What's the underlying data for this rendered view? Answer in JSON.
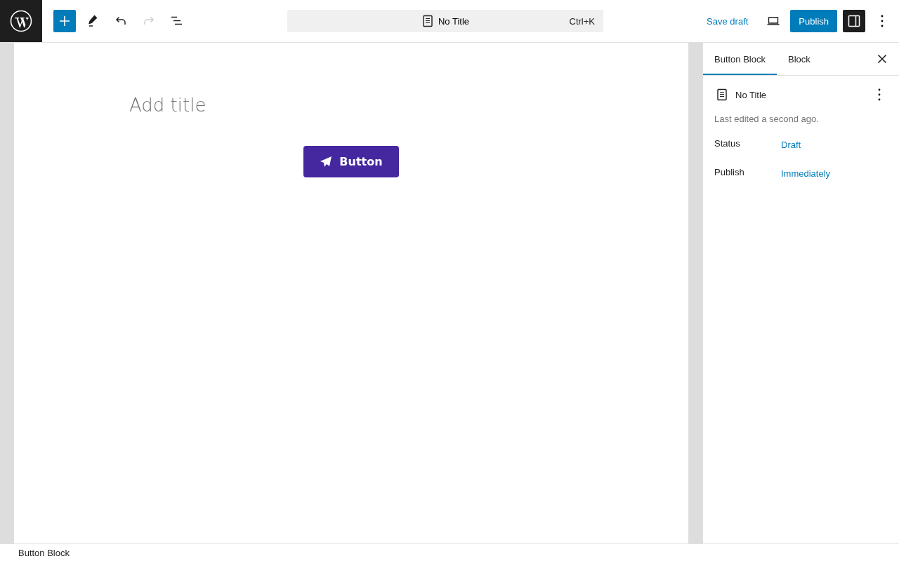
{
  "toolbar": {
    "undo": {
      "disabled": false
    },
    "redo": {
      "disabled": true
    }
  },
  "command_bar": {
    "document_title": "No Title",
    "shortcut": "Ctrl+K"
  },
  "actions": {
    "save_draft": "Save draft",
    "publish": "Publish",
    "settings_toggle": {
      "pressed": true
    }
  },
  "canvas": {
    "title_placeholder": "Add title",
    "button_label": "Button"
  },
  "sidebar": {
    "tabs": [
      {
        "label": "Button Block",
        "selected": true
      },
      {
        "label": "Block",
        "selected": false
      }
    ],
    "document_title": "No Title",
    "last_edited": "Last edited a second ago.",
    "rows": [
      {
        "label": "Status",
        "value": "Draft"
      },
      {
        "label": "Publish",
        "value": "Immediately"
      }
    ]
  },
  "footer": {
    "breadcrumb": "Button Block"
  }
}
